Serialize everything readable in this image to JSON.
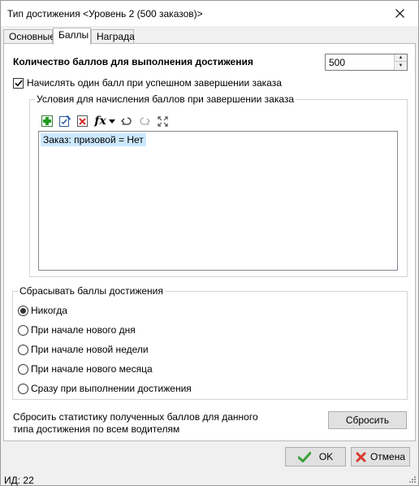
{
  "window": {
    "title": "Тип достижения <Уровень 2 (500 заказов)>"
  },
  "tabs": [
    {
      "label": "Основные"
    },
    {
      "label": "Баллы"
    },
    {
      "label": "Награда"
    }
  ],
  "points": {
    "label": "Количество баллов для выполнения достижения",
    "value": "500"
  },
  "award_on_completion": {
    "label": "Начислять один балл при успешном завершении заказа",
    "checked": true
  },
  "conditions": {
    "caption": "Условия для начисления баллов при завершении заказа",
    "toolbar": {
      "add": "add-icon",
      "edit": "edit-icon",
      "delete": "delete-icon",
      "fx": "fx",
      "undo": "undo-icon",
      "redo": "redo-icon",
      "expand": "expand-icon"
    },
    "items": [
      "Заказ: призовой = Нет"
    ]
  },
  "reset_group": {
    "caption": "Сбрасывать баллы достижения",
    "options": [
      {
        "label": "Никогда",
        "selected": true
      },
      {
        "label": "При начале нового дня",
        "selected": false
      },
      {
        "label": "При начале новой недели",
        "selected": false
      },
      {
        "label": "При начале нового месяца",
        "selected": false
      },
      {
        "label": "Сразу при выполнении достижения",
        "selected": false
      }
    ]
  },
  "reset_stats": {
    "text": "Сбросить статистику полученных баллов для данного типа достижения по всем водителям",
    "button": "Сбросить"
  },
  "footer": {
    "ok": "OK",
    "cancel": "Отмена"
  },
  "status": {
    "id_label": "ИД: 22"
  },
  "colors": {
    "selection": "#cce8ff",
    "ok_check": "#3ba03b",
    "cancel_x": "#d83a2c"
  }
}
